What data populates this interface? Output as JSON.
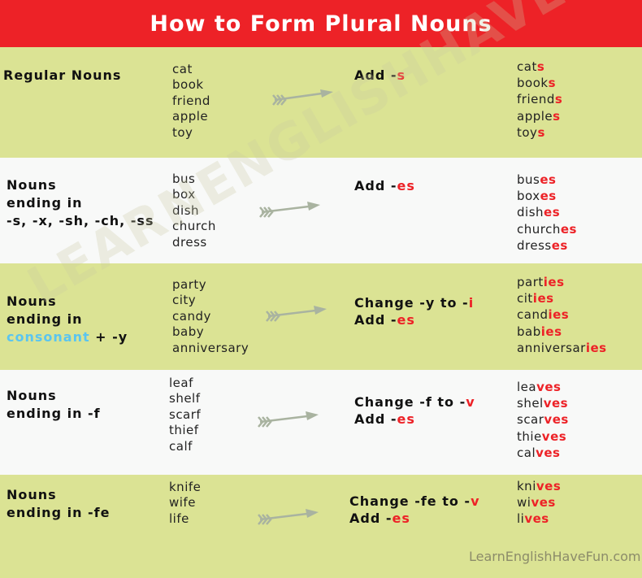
{
  "title": "How to Form Plural Nouns",
  "rows": [
    {
      "category": [
        "Regular Nouns"
      ],
      "singulars": [
        "cat",
        "book",
        "friend",
        "apple",
        "toy"
      ],
      "rule_lines": [
        {
          "text": "Add -",
          "suffix": "s"
        }
      ],
      "plurals": [
        {
          "stem": "cat",
          "ending": "s"
        },
        {
          "stem": "book",
          "ending": "s"
        },
        {
          "stem": "friend",
          "ending": "s"
        },
        {
          "stem": "apple",
          "ending": "s"
        },
        {
          "stem": "toy",
          "ending": "s"
        }
      ]
    },
    {
      "category": [
        "Nouns",
        "ending in",
        "-s, -x, -sh, -ch, -ss"
      ],
      "singulars": [
        "bus",
        "box",
        "dish",
        "church",
        "dress"
      ],
      "rule_lines": [
        {
          "text": "Add -",
          "suffix": "es"
        }
      ],
      "plurals": [
        {
          "stem": "bus",
          "ending": "es"
        },
        {
          "stem": "box",
          "ending": "es"
        },
        {
          "stem": "dish",
          "ending": "es"
        },
        {
          "stem": "church",
          "ending": "es"
        },
        {
          "stem": "dress",
          "ending": "es"
        }
      ]
    },
    {
      "category": [
        "Nouns",
        "ending in"
      ],
      "category_highlight": "consonant",
      "category_tail": " + -y",
      "singulars": [
        "party",
        "city",
        "candy",
        "baby",
        "anniversary"
      ],
      "rule_lines": [
        {
          "text": "Change -y to -",
          "suffix": "i"
        },
        {
          "text": "Add -",
          "suffix": "es"
        }
      ],
      "plurals": [
        {
          "stem": "part",
          "ending": "ies"
        },
        {
          "stem": "cit",
          "ending": "ies"
        },
        {
          "stem": "cand",
          "ending": "ies"
        },
        {
          "stem": "bab",
          "ending": "ies"
        },
        {
          "stem": "anniversar",
          "ending": "ies"
        }
      ]
    },
    {
      "category": [
        "Nouns",
        "ending in -f"
      ],
      "singulars": [
        "leaf",
        "shelf",
        "scarf",
        "thief",
        "calf"
      ],
      "rule_lines": [
        {
          "text": "Change -f to -",
          "suffix": "v"
        },
        {
          "text": "Add -",
          "suffix": "es"
        }
      ],
      "plurals": [
        {
          "stem": "lea",
          "ending": "ves"
        },
        {
          "stem": "shel",
          "ending": "ves"
        },
        {
          "stem": "scar",
          "ending": "ves"
        },
        {
          "stem": "thie",
          "ending": "ves"
        },
        {
          "stem": "cal",
          "ending": "ves"
        }
      ]
    },
    {
      "category": [
        "Nouns",
        "ending in -fe"
      ],
      "singulars": [
        "knife",
        "wife",
        "life"
      ],
      "rule_lines": [
        {
          "text": "Change -fe to -",
          "suffix": "v"
        },
        {
          "text": "Add -",
          "suffix": "es"
        }
      ],
      "plurals": [
        {
          "stem": "kni",
          "ending": "ves"
        },
        {
          "stem": "wi",
          "ending": "ves"
        },
        {
          "stem": "li",
          "ending": "ves"
        }
      ]
    }
  ],
  "watermark": "LEARNENGLISHHAVEFUN.COM",
  "footer": "LearnEnglishHaveFun.com",
  "colors": {
    "header_red": "#ed2227",
    "row_green": "#dbe394",
    "row_white": "#f8f9f8",
    "suffix_red": "#ed2227",
    "highlight_blue": "#5bc5ef",
    "arrow_gray": "#a9b3a0"
  }
}
